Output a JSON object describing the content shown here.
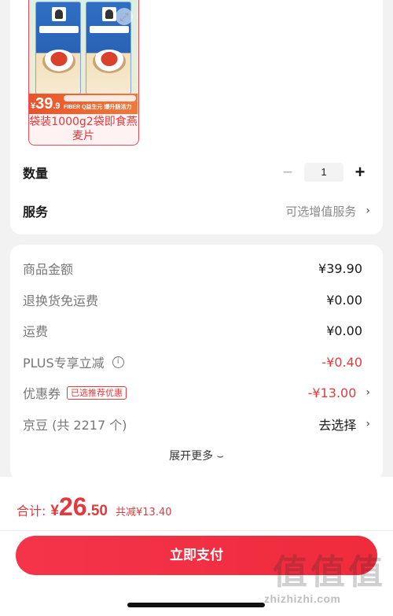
{
  "product": {
    "image_price": {
      "yen": "¥",
      "int": "39",
      "dec": ".9"
    },
    "image_slogan": "FIBER Q益生元 爆升肠活力",
    "sku_name": "袋装1000g2袋即食燕麦片"
  },
  "quantity": {
    "label": "数量",
    "minus": "−",
    "value": "1",
    "plus": "+"
  },
  "service": {
    "label": "服务",
    "value": "可选增值服务",
    "chevron": "›"
  },
  "summary": {
    "rows": [
      {
        "label": "商品金额",
        "value": "¥39.90"
      },
      {
        "label": "退换货免运费",
        "value": "¥0.00"
      },
      {
        "label": "运费",
        "value": "¥0.00"
      },
      {
        "label": "PLUS专享立减",
        "value": "-¥0.40",
        "info_icon": "i"
      },
      {
        "label": "优惠券",
        "badge": "已选推荐优惠",
        "value": "-¥13.00",
        "chevron": "›"
      },
      {
        "label": "京豆 (共 2217 个)",
        "value": "去选择",
        "chevron": "›"
      }
    ],
    "expand_more": "展开更多 ⌣"
  },
  "footer": {
    "total_label": "合计:",
    "total_yen": "¥",
    "total_int": "26",
    "total_dec": ".50",
    "saved_text": "共减¥13.40",
    "pay_button": "立即支付"
  },
  "watermark": {
    "logo_chars": [
      "值",
      "值",
      "值"
    ],
    "url": "zhizhizhi.com"
  },
  "colors": {
    "accent": "#e4393c",
    "button": "#f5344a",
    "background": "#f2f2f2"
  }
}
